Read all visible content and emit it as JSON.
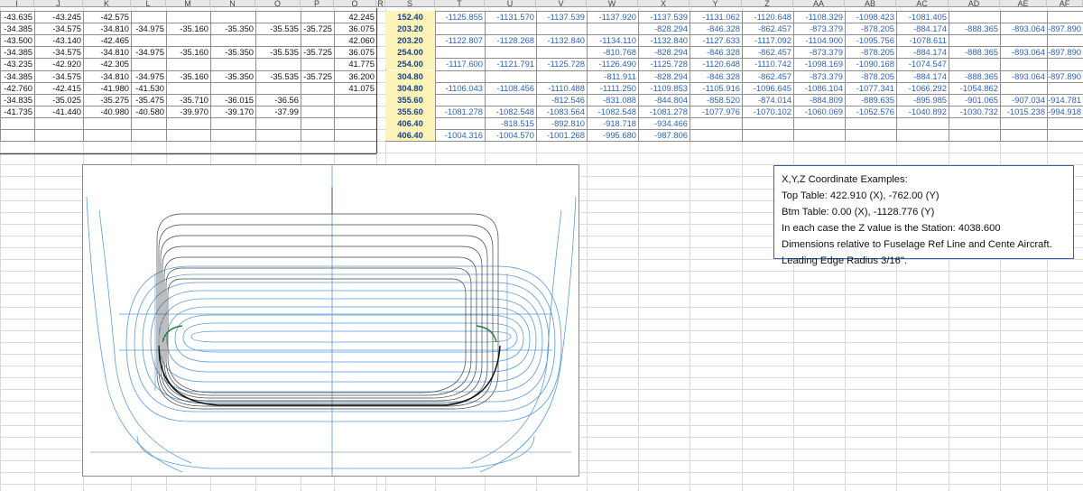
{
  "column_headers": [
    "I",
    "J",
    "K",
    "L",
    "M",
    "N",
    "O",
    "P",
    "Q",
    "R",
    "S",
    "T",
    "U",
    "V",
    "W",
    "X",
    "Y",
    "Z",
    "AA",
    "AB",
    "AC",
    "AD",
    "AE",
    "AF"
  ],
  "left_rows": [
    [
      "-43.635",
      "-43.245",
      "-42.575",
      "",
      "",
      "",
      "",
      "",
      "42.245"
    ],
    [
      "-34.385",
      "-34.575",
      "-34.810",
      "-34.975",
      "-35.160",
      "-35.350",
      "-35.535",
      "-35.725",
      "36.075"
    ],
    [
      "-43.500",
      "-43.140",
      "-42.465",
      "",
      "",
      "",
      "",
      "",
      "42.060"
    ],
    [
      "-34.385",
      "-34.575",
      "-34.810",
      "-34.975",
      "-35.160",
      "-35.350",
      "-35.535",
      "-35.725",
      "36.075"
    ],
    [
      "-43.235",
      "-42.920",
      "-42.305",
      "",
      "",
      "",
      "",
      "",
      "41.775"
    ],
    [
      "-34.385",
      "-34.575",
      "-34.810",
      "-34.975",
      "-35.160",
      "-35.350",
      "-35.535",
      "-35.725",
      "36.200"
    ],
    [
      "-42.760",
      "-42.415",
      "-41.980",
      "-41.530",
      "",
      "",
      "",
      "",
      "41.075"
    ],
    [
      "-34.835",
      "-35.025",
      "-35.275",
      "-35.475",
      "-35.710",
      "-36.015",
      "-36.56",
      "",
      ""
    ],
    [
      "-41.735",
      "-41.440",
      "-40.980",
      "-40.580",
      "-39.970",
      "-39.170",
      "-37.99",
      "",
      ""
    ]
  ],
  "station_values": [
    "152.40",
    "203.20",
    "203.20",
    "254.00",
    "254.00",
    "304.80",
    "304.80",
    "355.60",
    "355.60",
    "406.40",
    "406.40"
  ],
  "right_rows": [
    [
      "-1125.855",
      "-1131.570",
      "-1137.539",
      "-1137.920",
      "-1137.539",
      "-1131.062",
      "-1120.648",
      "-1108.329",
      "-1098.423",
      "-1081.405",
      "",
      "",
      ""
    ],
    [
      "",
      "",
      "",
      "",
      "-828.294",
      "-846.328",
      "-862.457",
      "-873.379",
      "-878.205",
      "-884.174",
      "-888.365",
      "-893.064",
      "-897.890"
    ],
    [
      "-1122.807",
      "-1128.268",
      "-1132.840",
      "-1134.110",
      "-1132.840",
      "-1127.633",
      "-1117.092",
      "-1104.900",
      "-1095.756",
      "-1078.611",
      "",
      "",
      ""
    ],
    [
      "",
      "",
      "",
      "-810.768",
      "-828.294",
      "-846.328",
      "-862.457",
      "-873.379",
      "-878.205",
      "-884.174",
      "-888.365",
      "-893.064",
      "-897.890"
    ],
    [
      "-1117.600",
      "-1121.791",
      "-1125.728",
      "-1126.490",
      "-1125.728",
      "-1120.648",
      "-1110.742",
      "-1098.169",
      "-1090.168",
      "-1074.547",
      "",
      "",
      ""
    ],
    [
      "",
      "",
      "",
      "-811.911",
      "-828.294",
      "-846.328",
      "-862.457",
      "-873.379",
      "-878.205",
      "-884.174",
      "-888.365",
      "-893.064",
      "-897.890"
    ],
    [
      "-1106.043",
      "-1108.456",
      "-1110.488",
      "-1111.250",
      "-1109.853",
      "-1105.916",
      "-1096.645",
      "-1086.104",
      "-1077.341",
      "-1066.292",
      "-1054.862",
      "",
      ""
    ],
    [
      "",
      "",
      "-812.546",
      "-831.088",
      "-844.804",
      "-858.520",
      "-874.014",
      "-884.809",
      "-889.635",
      "-895.985",
      "-901.065",
      "-907.034",
      "-914.781"
    ],
    [
      "-1081.278",
      "-1082.548",
      "-1083.564",
      "-1082.548",
      "-1081.278",
      "-1077.976",
      "-1070.102",
      "-1060.069",
      "-1052.576",
      "-1040.892",
      "-1030.732",
      "-1015.238",
      "-994.918"
    ],
    [
      "",
      "-818.515",
      "-892.810",
      "-918.718",
      "-934.466",
      "",
      "",
      "",
      "",
      "",
      "",
      "",
      ""
    ],
    [
      "-1004.316",
      "-1004.570",
      "-1001.268",
      "-995.680",
      "-987.806",
      "",
      "",
      "",
      "",
      "",
      "",
      "",
      ""
    ]
  ],
  "note": {
    "lines": [
      "X,Y,Z Coordinate Examples:",
      "Top Table: 422.910 (X), -762.00 (Y)",
      "Btm Table: 0.00 (X), -1128.776 (Y)",
      "In each case the Z value is the Station: 4038.600",
      "Dimensions relative to Fuselage Ref Line and Cente Aircraft.",
      "Leading Edge Radius 3/16\"."
    ]
  },
  "colors": {
    "station_fill": "#fbf3b8",
    "blue_text": "#2f63b4",
    "blue_curves": "#5b9bd5",
    "black_curves": "#444444"
  }
}
